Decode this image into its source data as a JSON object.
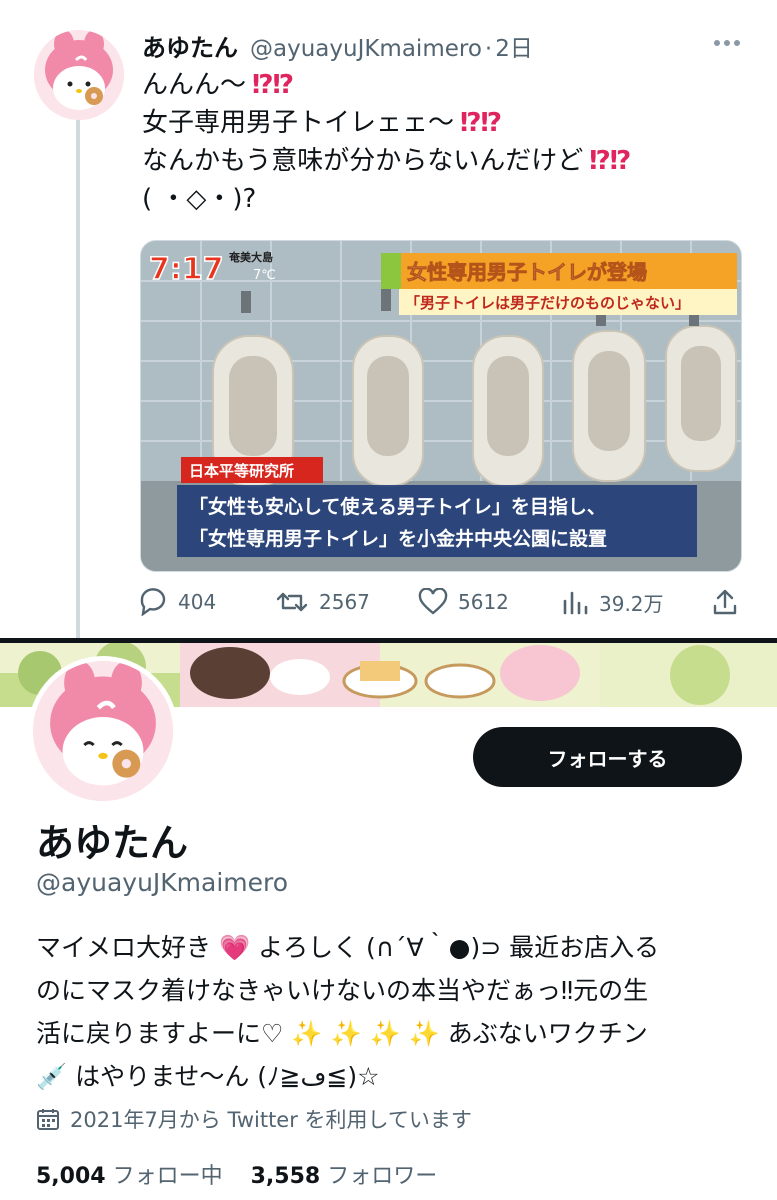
{
  "tweet": {
    "name": "あゆたん",
    "handle": "@ayuayuJKmaimero",
    "separator": "·",
    "time": "2日",
    "lines": [
      "んんん〜",
      "女子専用男子トイレェェ〜",
      "なんかもう意味が分からないんだけど",
      "( ・◇・)?"
    ],
    "exclaim": "⁉⁉",
    "media": {
      "clock": "7:17",
      "location": "奄美大島",
      "temp": "7℃",
      "headline": "女性専用男子トイレが登場",
      "subheadline": "「男子トイレは男子だけのものじゃない」",
      "source": "日本平等研究所",
      "caption1": "「女性も安心して使える男子トイレ」を目指し、",
      "caption2": "「女性専用男子トイレ」を小金井中央公園に設置"
    },
    "actions": {
      "replies": "404",
      "retweets": "2567",
      "likes": "5612",
      "views": "39.2万"
    }
  },
  "profile": {
    "follow_label": "フォローする",
    "name": "あゆたん",
    "handle": "@ayuayuJKmaimero",
    "bio": {
      "line1_a": "マイメロ大好き",
      "line1_heart": "💗",
      "line1_b": "よろしく (∩´∀｀●)⊃ 最近お店入る",
      "line2": "のにマスク着けなきゃいけないの本当やだぁっ‼元の生",
      "line3_a": "活に戻りますよーに♡",
      "sparkles": "✨ ✨ ✨ ✨",
      "line3_b": "あぶないワクチン",
      "line4_icon": "💉",
      "line4": "はやりませ〜ん (ﾉ≧ڡ≦)☆"
    },
    "joined": "2021年7月から Twitter を利用しています",
    "following_count": "5,004",
    "following_label": "フォロー中",
    "followers_count": "3,558",
    "followers_label": "フォロワー"
  },
  "colors": {
    "text": "#0f1419",
    "secondary": "#536471",
    "exclaim": "#e0245e",
    "button": "#0f1419"
  }
}
